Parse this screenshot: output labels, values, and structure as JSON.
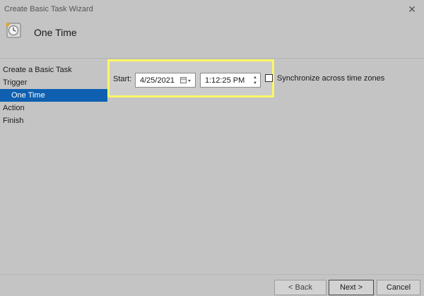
{
  "window": {
    "title": "Create Basic Task Wizard",
    "close_glyph": "✕"
  },
  "header": {
    "title": "One Time",
    "icon": "task-clock-icon"
  },
  "nav": {
    "items": [
      {
        "label": "Create a Basic Task",
        "selected": false,
        "sub": false
      },
      {
        "label": "Trigger",
        "selected": false,
        "sub": false
      },
      {
        "label": "One Time",
        "selected": true,
        "sub": true
      },
      {
        "label": "Action",
        "selected": false,
        "sub": false
      },
      {
        "label": "Finish",
        "selected": false,
        "sub": false
      }
    ]
  },
  "start": {
    "label": "Start:",
    "date": "4/25/2021",
    "time": "1:12:25 PM",
    "sync_label": "Synchronize across time zones",
    "sync_checked": false
  },
  "buttons": {
    "back": "< Back",
    "next": "Next >",
    "cancel": "Cancel"
  },
  "colors": {
    "background": "#c4c4c4",
    "selected": "#0f60b0",
    "highlight": "#fcf765"
  }
}
